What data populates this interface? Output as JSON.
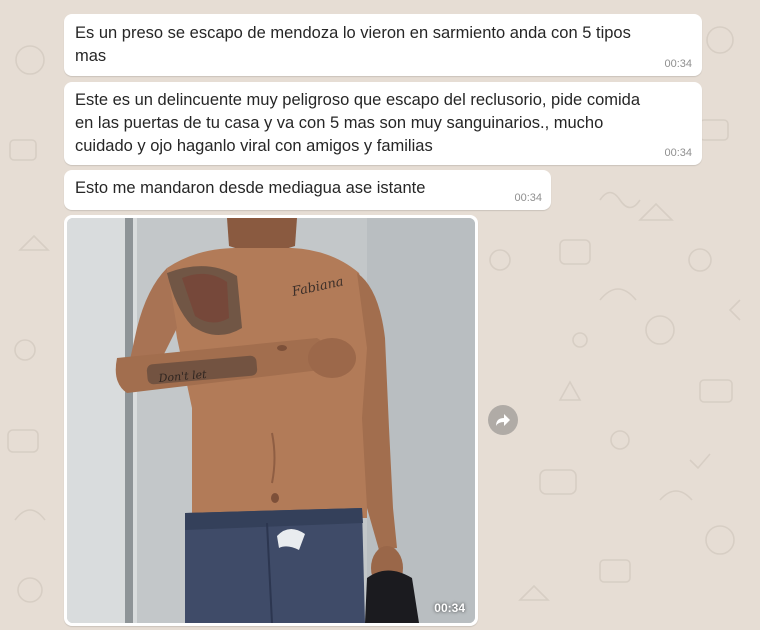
{
  "theme": {
    "wallpaper_color": "#e6ddd4",
    "bubble_color": "#ffffff",
    "text_color": "#262626",
    "time_color": "#8f8f8f"
  },
  "messages": [
    {
      "text": "Es un preso se escapo de mendoza lo vieron en sarmiento anda con 5 tipos\nmas",
      "time": "00:34"
    },
    {
      "text": "Este es un delincuente muy peligroso que escapo del reclusorio, pide comida\nen las puertas de tu casa y va con 5 mas son muy sanguinarios., mucho\ncuidado y ojo haganlo viral con amigos y familias",
      "time": "00:34"
    },
    {
      "text": "Esto me mandaron desde mediagua ase istante",
      "time": "00:34"
    }
  ],
  "photo_message": {
    "time": "00:34",
    "tattoo_chest_text": "Fabiana",
    "tattoo_arm_text": "Don't let"
  },
  "icons": {
    "forward": "forward-arrow-icon"
  }
}
